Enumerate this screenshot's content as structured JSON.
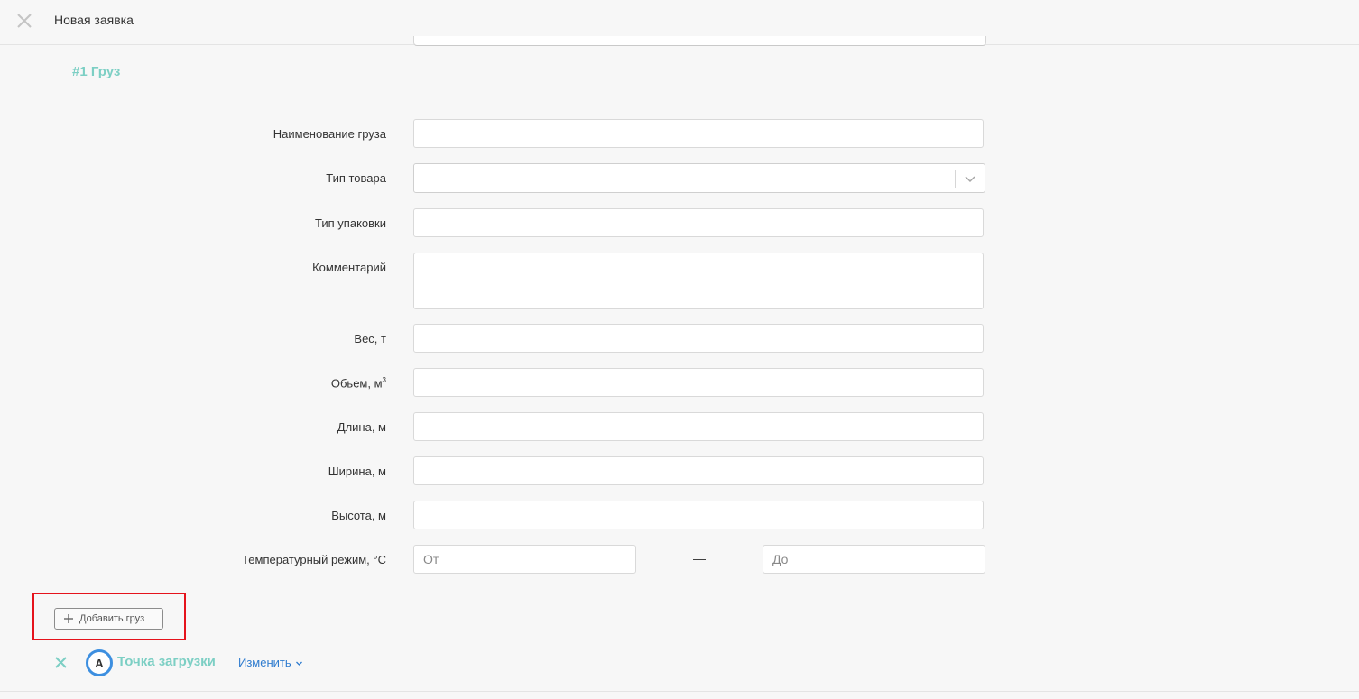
{
  "header": {
    "title": "Новая заявка"
  },
  "cargo_section": {
    "title": "#1 Груз",
    "fields": {
      "name_label": "Наименование груза",
      "name_value": "",
      "product_type_label": "Тип товара",
      "product_type_value": "",
      "package_type_label": "Тип упаковки",
      "package_type_value": "",
      "comment_label": "Комментарий",
      "comment_value": "",
      "weight_label": "Вес, т",
      "weight_value": "",
      "volume_label": "Обьем, м",
      "volume_sup": "3",
      "volume_value": "",
      "length_label": "Длина, м",
      "length_value": "",
      "width_label": "Ширина, м",
      "width_value": "",
      "height_label": "Высота, м",
      "height_value": "",
      "temp_label": "Температурный режим, °С",
      "temp_from_placeholder": "От",
      "temp_to_placeholder": "До",
      "temp_dash": "—"
    },
    "add_button_label": "Добавить груз"
  },
  "loading_point": {
    "badge": "A",
    "title": "Точка загрузки",
    "change_label": "Изменить"
  },
  "colors": {
    "accent_teal": "#7ccfc4",
    "link_blue": "#2f7ccf",
    "badge_blue": "#3d8fe0",
    "highlight_red": "#e5131c",
    "background": "#f7f7f7"
  },
  "icons": {
    "close": "close-icon",
    "dropdown": "chevron-down-icon",
    "add": "plus-icon",
    "remove": "close-icon"
  }
}
